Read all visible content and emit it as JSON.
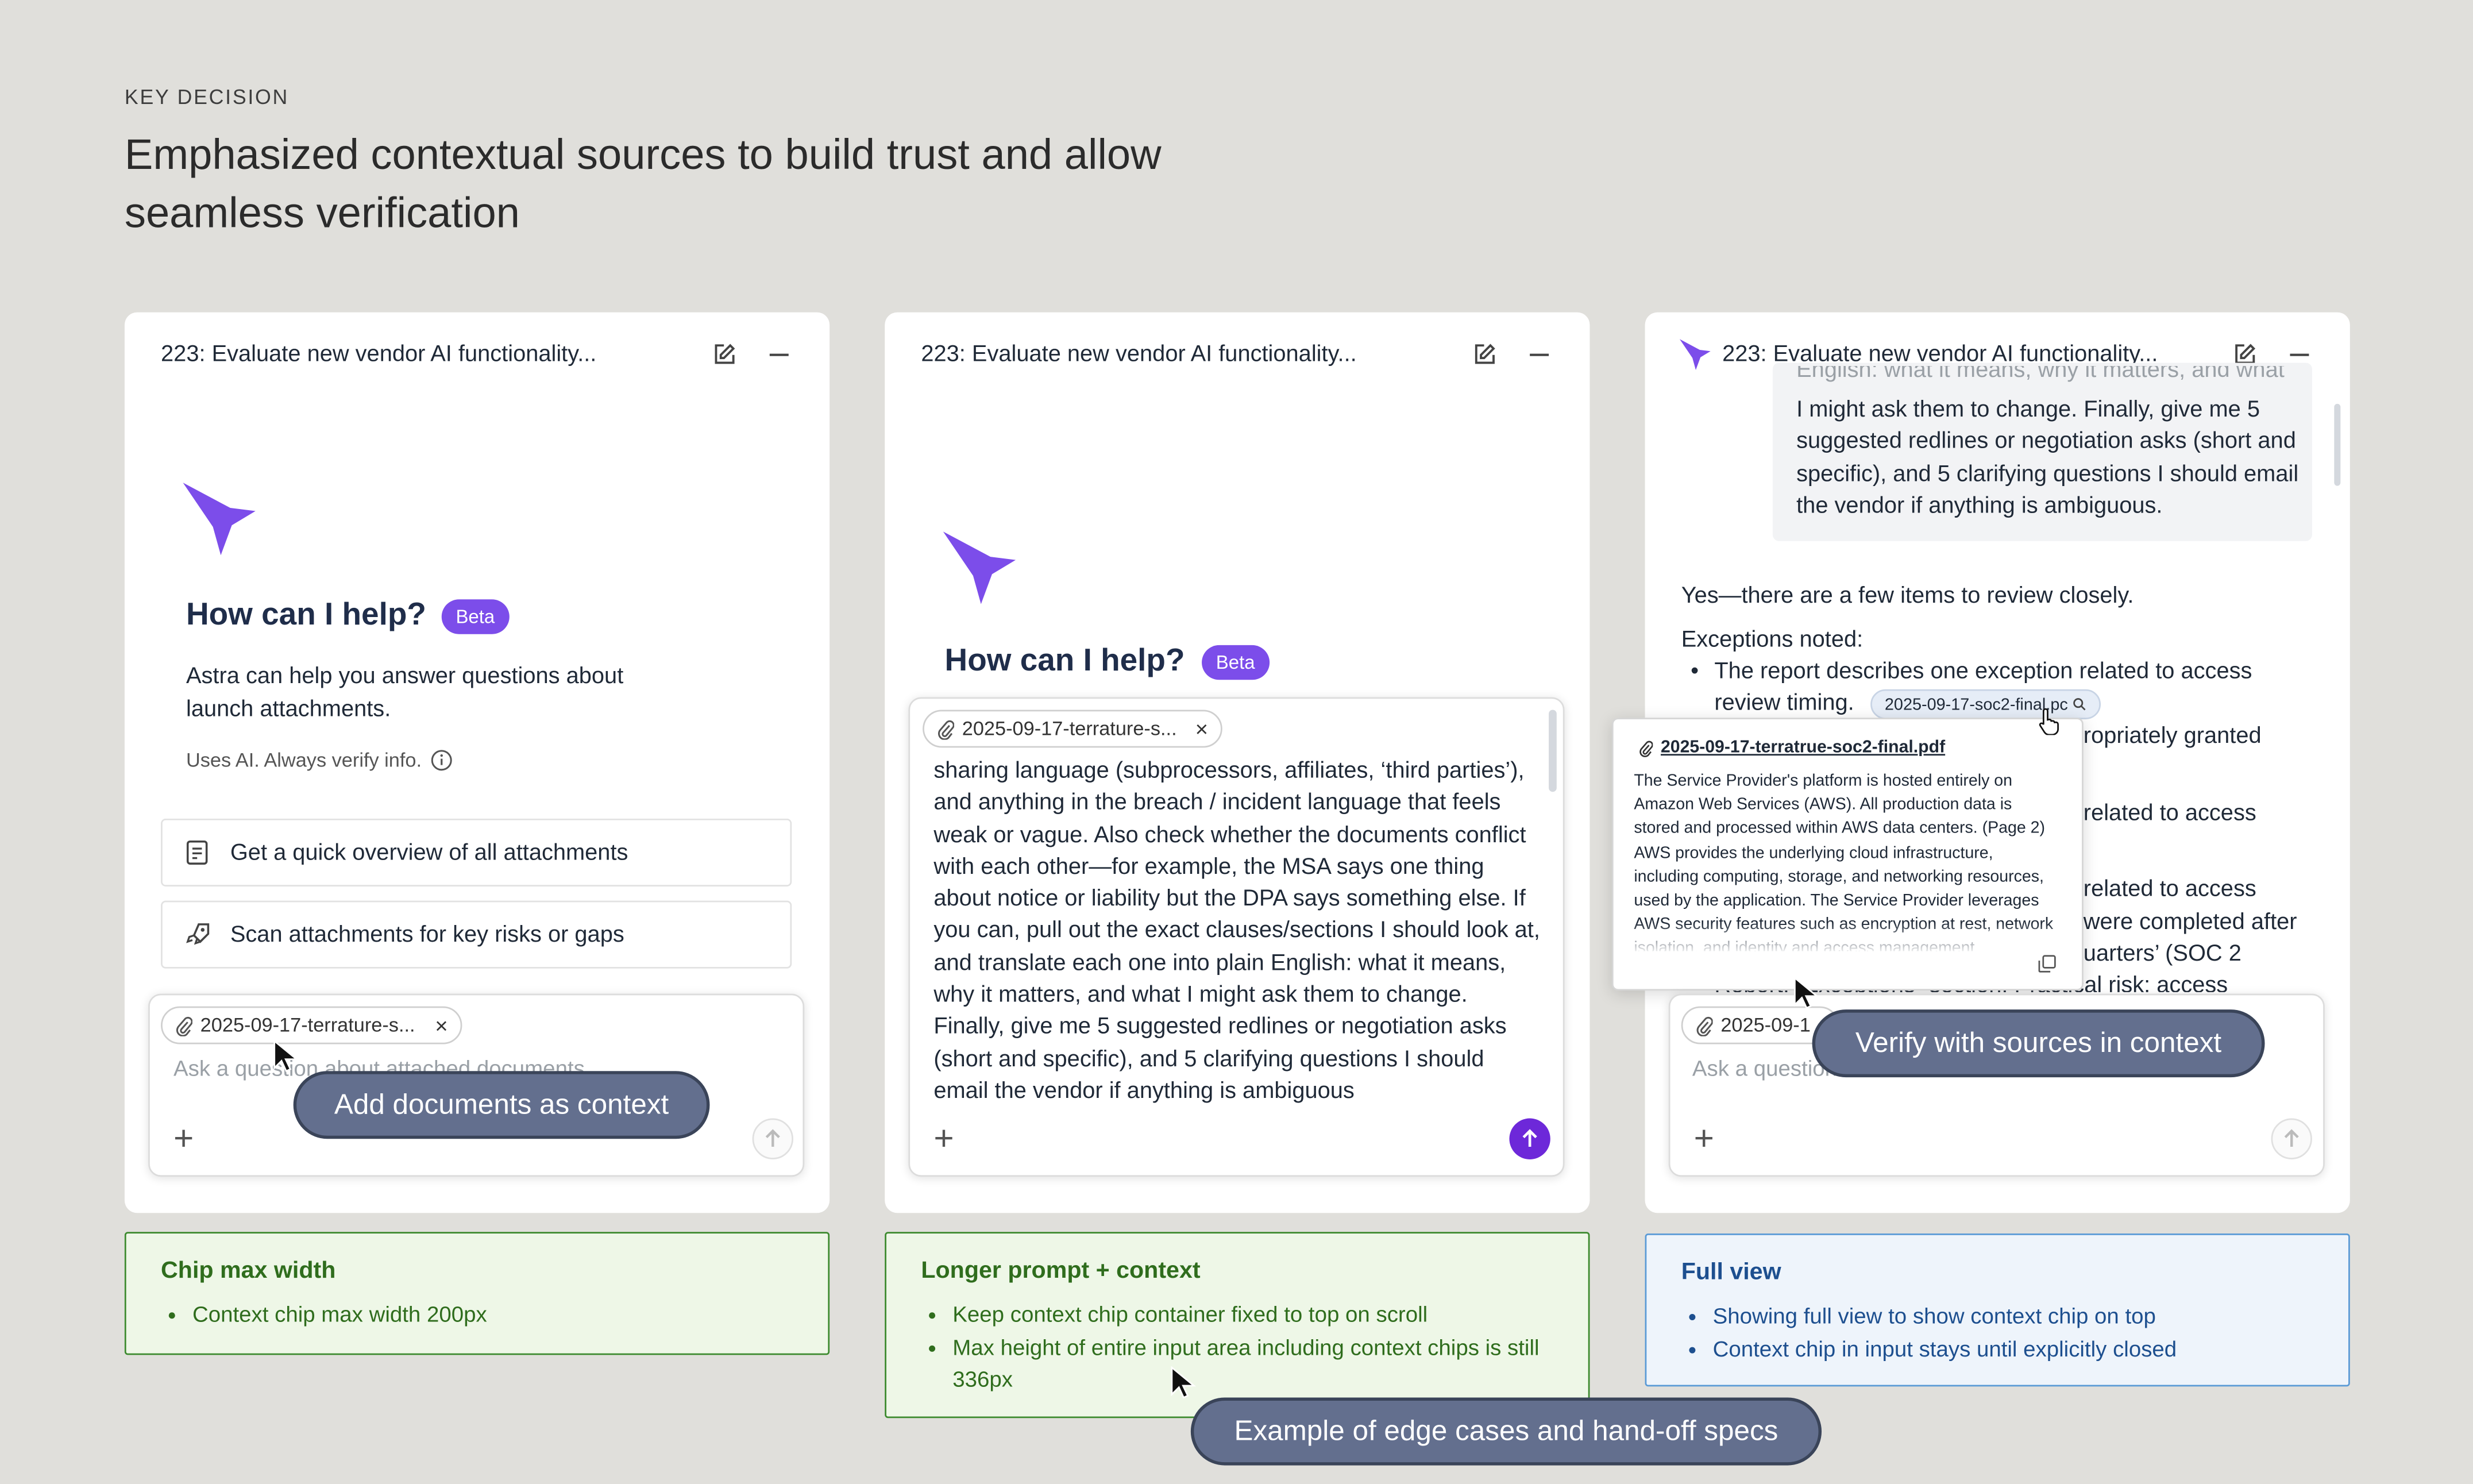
{
  "header": {
    "eyebrow": "KEY DECISION",
    "headline": "Emphasized contextual sources to build trust and allow seamless verification"
  },
  "colors": {
    "accent": "#7c4dea",
    "pill": "#636f8e",
    "green_note": "#3c8a2e",
    "blue_note": "#5a9ad6"
  },
  "panel1": {
    "title": "223: Evaluate new vendor AI functionality...",
    "help_title": "How can I help?",
    "beta": "Beta",
    "description": "Astra can help you answer questions about launch attachments.",
    "uses_ai": "Uses AI. Always verify info.",
    "suggestions": [
      {
        "icon": "document-overview-icon",
        "label": "Get a quick overview of all attachments"
      },
      {
        "icon": "rocket-icon",
        "label": "Scan attachments for key risks or gaps"
      }
    ],
    "chip_label": "2025-09-17-terrature-s...",
    "placeholder": "Ask a question about attached documents",
    "callout": "Add documents as context"
  },
  "panel2": {
    "title": "223: Evaluate new vendor AI functionality...",
    "help_title": "How can I help?",
    "beta": "Beta",
    "chip_label": "2025-09-17-terrature-s...",
    "prompt_text": "sharing language (subprocessors, affiliates, ‘third parties’), and anything in the breach / incident language that feels weak or vague. Also check whether the documents conflict with each other—for example, the MSA says one thing about notice or liability but the DPA says something else. If you can, pull out the exact clauses/sections I should look at, and translate each one into plain English: what it means, why it matters, and what I might ask them to change. Finally, give me 5 suggested redlines or negotiation asks (short and specific), and 5 clarifying questions I should email the vendor if anything is ambiguous",
    "callout": "Example of edge cases and hand-off specs"
  },
  "panel3": {
    "title": "223: Evaluate new vendor AI functionality...",
    "user_message_partial": "English: what it means, why it matters, and what",
    "user_message": "I might ask them to change. Finally, give me 5 suggested redlines or negotiation asks (short and specific), and 5 clarifying questions I should email the vendor if anything is ambiguous.",
    "answer_intro": "Yes—there are a few items to review closely.",
    "exceptions_label": "Exceptions noted:",
    "bullet_1": "The report describes one exception related to access review timing.",
    "source_chip": "2025-09-17-soc2-final.pc",
    "fragment_1": "ropriately granted",
    "fragment_2": "related to access",
    "fragment_3": "related to access",
    "fragment_4": "were completed after",
    "fragment_5": "uarters’ (SOC 2",
    "fragment_6": "Report: “Exceptions” section. Practical risk: access",
    "popover_title": "2025-09-17-terratrue-soc2-final.pdf",
    "popover_text": "The Service Provider's platform is hosted entirely on Amazon Web Services (AWS). All production data is stored and processed within AWS data centers. (Page 2) AWS provides the underlying cloud infrastructure, including computing, storage, and networking resources, used by the application. The Service Provider leverages AWS security features such as encryption at rest, network isolation, and identity and access management.",
    "chip_label": "2025-09-1",
    "placeholder": "Ask a question",
    "callout": "Verify with sources in context"
  },
  "notes": {
    "note1": {
      "title": "Chip max width",
      "items": [
        "Context chip max width 200px"
      ]
    },
    "note2": {
      "title": "Longer prompt + context",
      "items": [
        "Keep context chip container fixed to top on scroll",
        "Max height of entire input area including context chips is still 336px"
      ]
    },
    "note3": {
      "title": "Full view",
      "items": [
        "Showing full view to show context chip on top",
        "Context chip in input stays until explicitly closed"
      ]
    }
  }
}
